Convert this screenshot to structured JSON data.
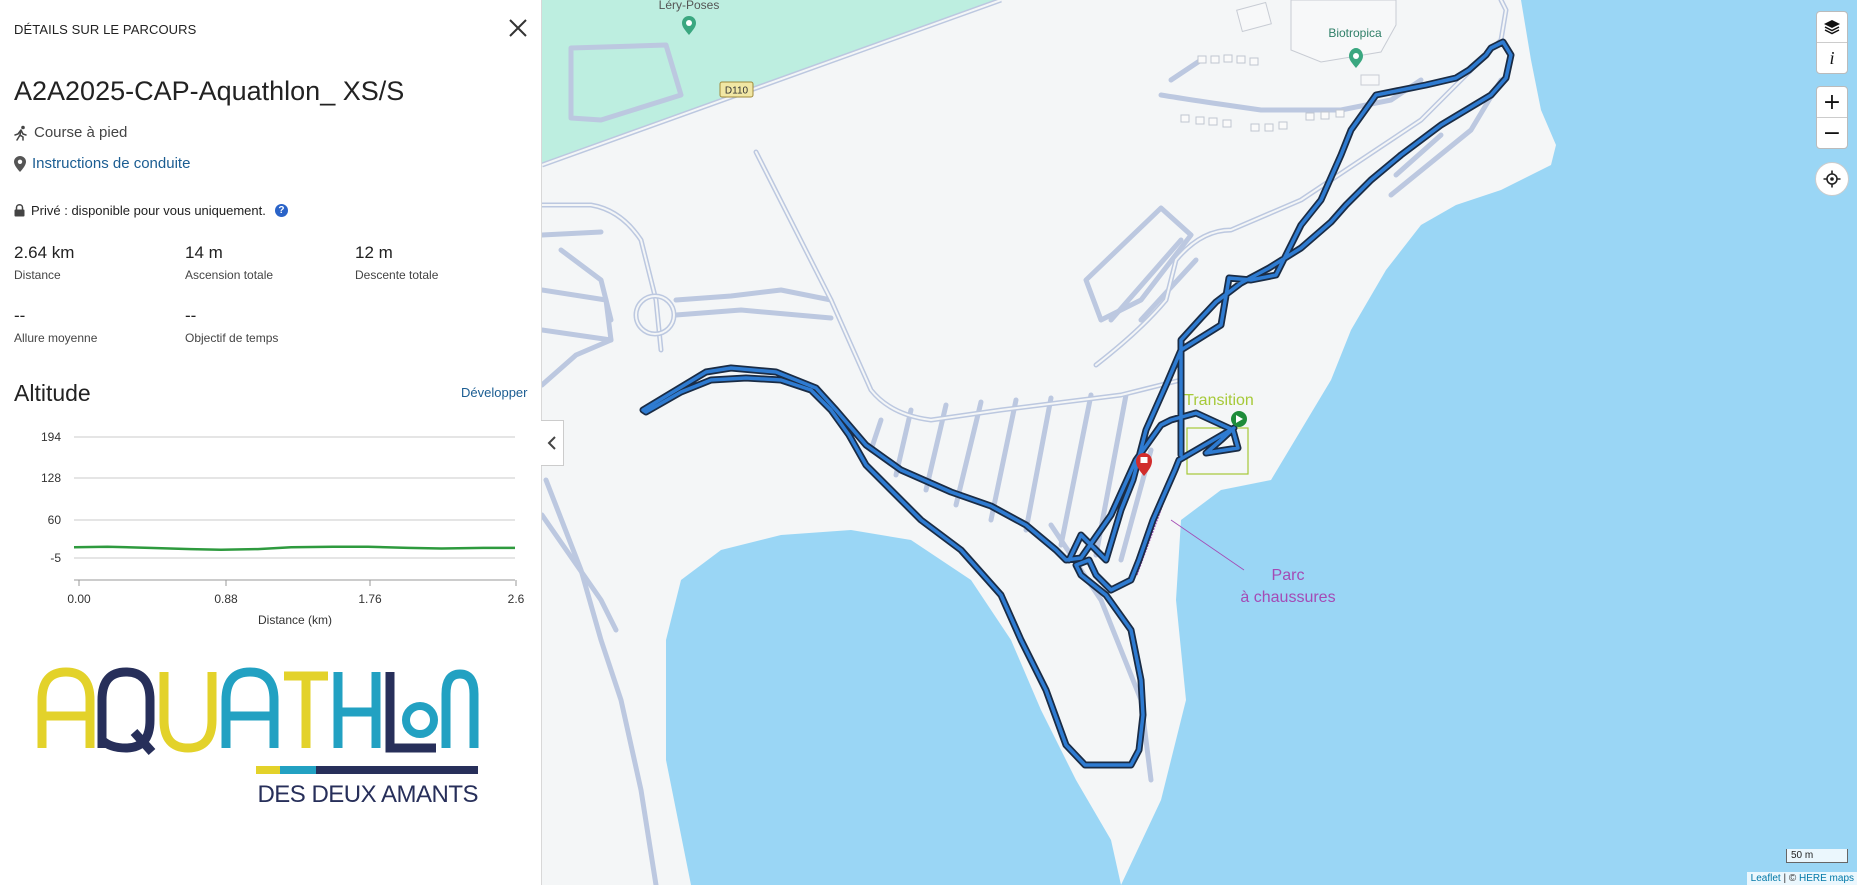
{
  "panel": {
    "header": "DÉTAILS SUR LE PARCOURS",
    "close_icon": "close-icon",
    "route_name": "A2A2025-CAP-Aquathlon_ XS/S",
    "activity": "Course à pied",
    "directions_link": "Instructions de conduite",
    "privacy": "Privé : disponible pour vous uniquement.",
    "stats": [
      {
        "value": "2.64 km",
        "label": "Distance"
      },
      {
        "value": "14 m",
        "label": "Ascension totale"
      },
      {
        "value": "12 m",
        "label": "Descente totale"
      },
      {
        "value": "--",
        "label": "Allure moyenne"
      },
      {
        "value": "--",
        "label": "Objectif de temps"
      }
    ],
    "altitude_title": "Altitude",
    "expand_link": "Développer"
  },
  "chart_data": {
    "type": "line",
    "title": "",
    "xlabel": "Distance (km)",
    "ylabel": "",
    "y_ticks": [
      "194",
      "128",
      "60",
      "-5"
    ],
    "x_ticks": [
      "0.00",
      "0.88",
      "1.76",
      "2.6"
    ],
    "ylim": [
      -5,
      194
    ],
    "xlim": [
      0,
      2.64
    ],
    "series": [
      {
        "x": [
          0,
          0.2,
          0.45,
          0.7,
          0.88,
          1.1,
          1.3,
          1.55,
          1.76,
          2.0,
          2.2,
          2.45,
          2.64
        ],
        "y": [
          3,
          4,
          2,
          0,
          -1,
          0,
          3,
          4,
          4,
          2,
          1,
          2,
          2
        ],
        "color": "#2e9a3e"
      }
    ]
  },
  "logo": {
    "word": "AQUATHLON",
    "subtitle": "DES DEUX AMANTS",
    "colors": {
      "yellow": "#e3d22a",
      "navy": "#272f5a",
      "teal": "#22a1c2"
    }
  },
  "map": {
    "labels": {
      "lery_poses": "Léry-Poses",
      "biotropica": "Biotropica",
      "road": "D110",
      "transition": "Transition",
      "parc_line1": "Parc",
      "parc_line2": "à chaussures"
    },
    "controls": {
      "layers_icon": "layers-icon",
      "info": "i",
      "zoom_in": "+",
      "zoom_out": "−",
      "locate_icon": "locate-icon"
    },
    "scale": "50 m",
    "attribution_leaflet": "Leaflet",
    "attribution_sep": " | © ",
    "attribution_here": "HERE maps",
    "colors": {
      "water": "#9ad6f5",
      "park": "#bdeee0",
      "land": "#f4f6f7",
      "road_outline": "#bcc8e0",
      "route": "#2e7bd1",
      "transition": "#a6c938",
      "parc": "#a44bb5"
    }
  }
}
